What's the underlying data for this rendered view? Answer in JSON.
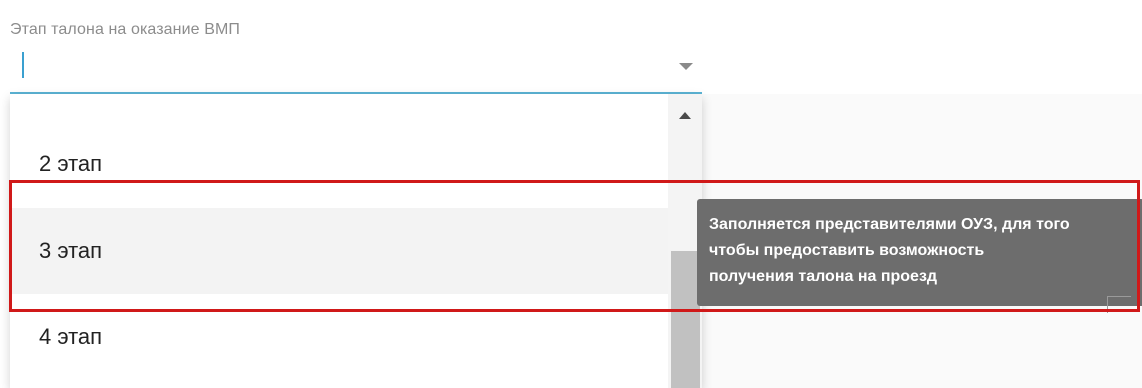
{
  "field": {
    "label": "Этап талона на оказание ВМП",
    "value": ""
  },
  "dropdown": {
    "options": [
      {
        "label": "2 этап"
      },
      {
        "label": "3 этап",
        "highlighted": true
      },
      {
        "label": "4 этап"
      }
    ]
  },
  "tooltip": {
    "lines": [
      "Заполняется представителями ОУЗ, для того",
      "чтобы предоставить возможность",
      "получения талона на проезд"
    ]
  },
  "colors": {
    "focus_underline": "#5bb3d4",
    "highlight_box": "#d01919",
    "tooltip_bg": "#6d6d6d",
    "hovered_option_bg": "#f3f3f3"
  },
  "icons": {
    "dropdown_arrow": "chevron-down-icon",
    "scroll_up": "scroll-up-arrow-icon"
  }
}
